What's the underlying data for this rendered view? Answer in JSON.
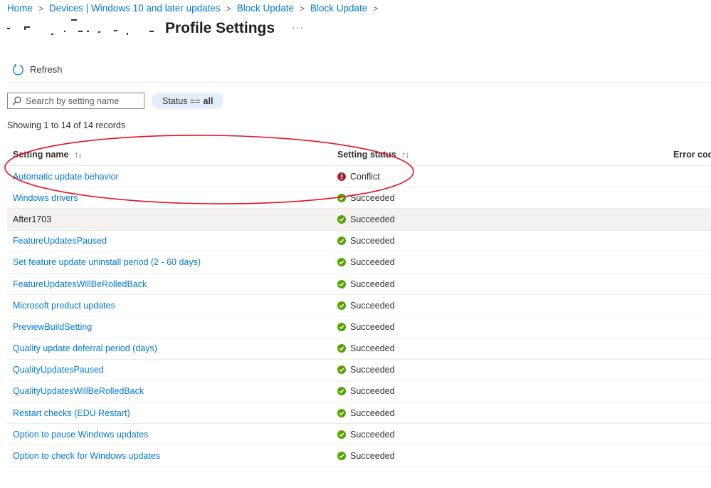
{
  "breadcrumb": [
    {
      "label": "Home"
    },
    {
      "label": "Devices | Windows 10 and later updates"
    },
    {
      "label": "Block Update"
    },
    {
      "label": "Block Update"
    }
  ],
  "header": {
    "title": "Profile Settings",
    "more_label": "···"
  },
  "toolbar": {
    "refresh_label": "Refresh",
    "refresh_icon": "refresh-icon"
  },
  "filters": {
    "search_placeholder": "Search by setting name",
    "search_value": "",
    "search_icon": "search-icon",
    "status_filter_prefix": "Status ==",
    "status_filter_value": "all"
  },
  "record_count": "Showing 1 to 14 of 14 records",
  "table": {
    "columns": [
      {
        "label": "Setting name",
        "sortable": true
      },
      {
        "label": "Setting status",
        "sortable": true
      },
      {
        "label": "Error code",
        "sortable": false
      }
    ],
    "sort_icon": "↑↓",
    "rows": [
      {
        "name": "Automatic update behavior",
        "status": "Conflict",
        "status_icon": "error-icon"
      },
      {
        "name": "Windows drivers",
        "status": "Succeeded",
        "status_icon": "check-icon"
      },
      {
        "name": "After1703",
        "status": "Succeeded",
        "status_icon": "check-icon",
        "hovered": true
      },
      {
        "name": "FeatureUpdatesPaused",
        "status": "Succeeded",
        "status_icon": "check-icon"
      },
      {
        "name": "Set feature update uninstall period (2 - 60 days)",
        "status": "Succeeded",
        "status_icon": "check-icon"
      },
      {
        "name": "FeatureUpdatesWillBeRolledBack",
        "status": "Succeeded",
        "status_icon": "check-icon"
      },
      {
        "name": "Microsoft product updates",
        "status": "Succeeded",
        "status_icon": "check-icon"
      },
      {
        "name": "PreviewBuildSetting",
        "status": "Succeeded",
        "status_icon": "check-icon"
      },
      {
        "name": "Quality update deferral period (days)",
        "status": "Succeeded",
        "status_icon": "check-icon"
      },
      {
        "name": "QualityUpdatesPaused",
        "status": "Succeeded",
        "status_icon": "check-icon"
      },
      {
        "name": "QualityUpdatesWillBeRolledBack",
        "status": "Succeeded",
        "status_icon": "check-icon"
      },
      {
        "name": "Restart checks (EDU Restart)",
        "status": "Succeeded",
        "status_icon": "check-icon"
      },
      {
        "name": "Option to pause Windows updates",
        "status": "Succeeded",
        "status_icon": "check-icon"
      },
      {
        "name": "Option to check for Windows updates",
        "status": "Succeeded",
        "status_icon": "check-icon"
      }
    ]
  },
  "colors": {
    "link": "#0078d4",
    "success": "#57a300",
    "conflict": "#a4262c",
    "annotation": "#e81123",
    "pill_bg": "#e3eefa",
    "hover_row": "#f3f2f1"
  }
}
